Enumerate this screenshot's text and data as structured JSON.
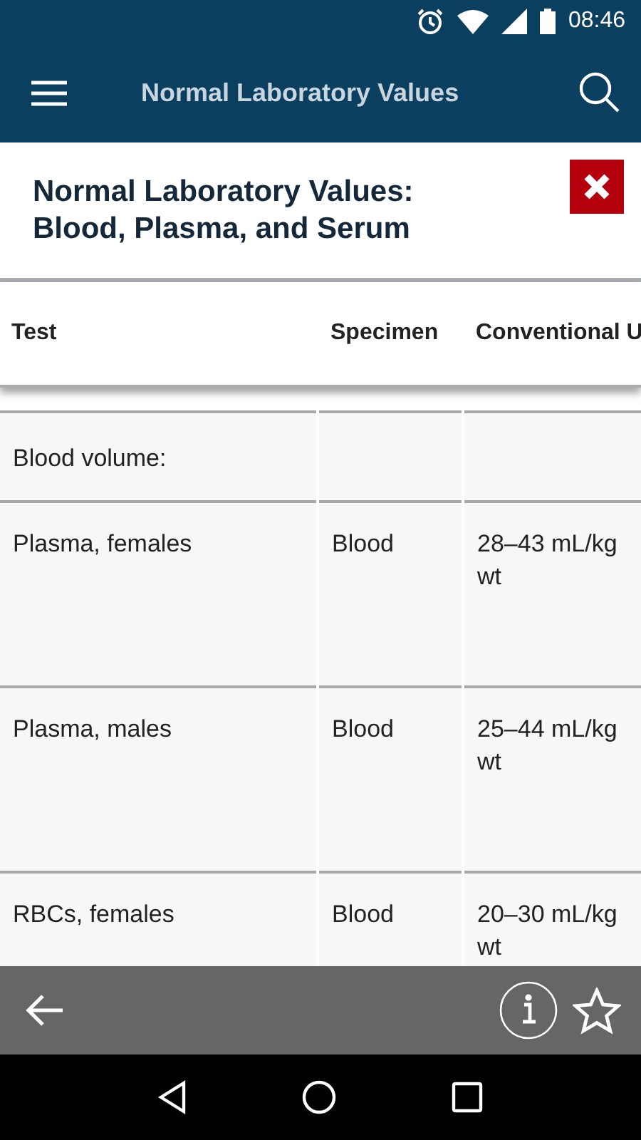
{
  "status_bar": {
    "time": "08:46"
  },
  "app_bar": {
    "title": "Normal Laboratory Values"
  },
  "panel": {
    "title": "Normal Laboratory Values: Blood, Plasma, and Serum"
  },
  "table": {
    "columns": [
      "Test",
      "Specimen",
      "Conventional U"
    ],
    "rows": [
      {
        "kind": "group",
        "test": "Blood volume:"
      },
      {
        "kind": "item",
        "test": "Plasma, females",
        "specimen": "Blood",
        "conventional": "28–43 mL/kg wt"
      },
      {
        "kind": "item",
        "test": "Plasma, males",
        "specimen": "Blood",
        "conventional": "25–44 mL/kg wt"
      },
      {
        "kind": "item",
        "test": "RBCs, females",
        "specimen": "Blood",
        "conventional": "20–30 mL/kg wt"
      }
    ]
  }
}
